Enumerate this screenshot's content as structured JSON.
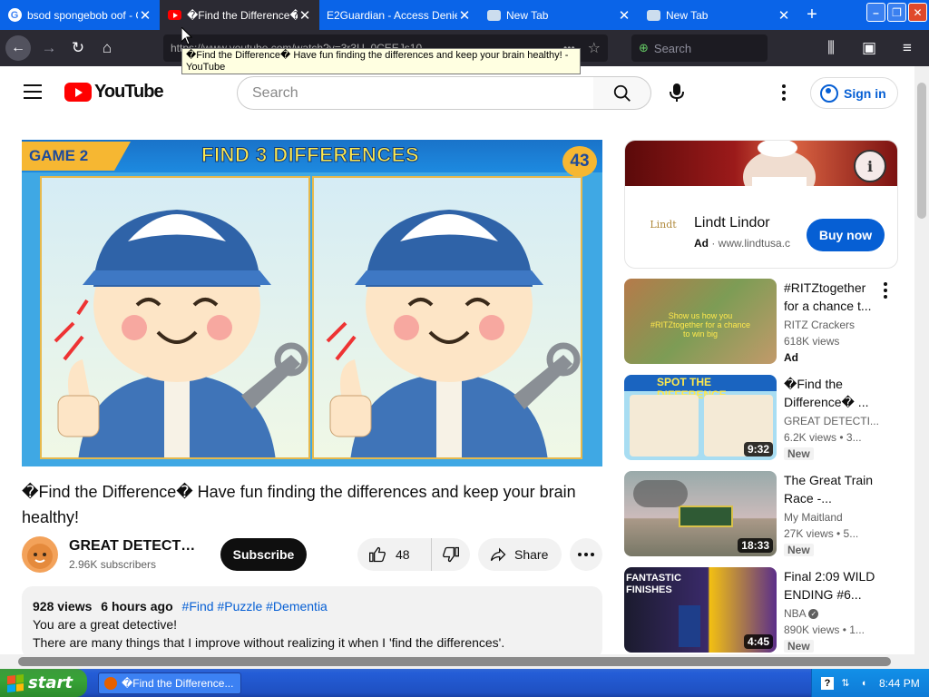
{
  "browser": {
    "tabs": [
      {
        "title": "bsod spongebob oof - G",
        "favicon": "google-icon",
        "active": false
      },
      {
        "title": "�Find the Difference�",
        "favicon": "youtube-icon",
        "active": true
      },
      {
        "title": "E2Guardian - Access Denied",
        "favicon": "none",
        "active": false
      },
      {
        "title": "New Tab",
        "favicon": "firefox-dog-icon",
        "active": false
      },
      {
        "title": "New Tab",
        "favicon": "firefox-dog-icon",
        "active": false
      }
    ],
    "url_text": "https://www.youtube.com/watch?v=3r3U_0CEEJs10",
    "search_placeholder": "Search",
    "tooltip": "�Find the Difference� Have fun finding the differences and keep your brain healthy! - YouTube"
  },
  "yt": {
    "logo_text": "YouTube",
    "search_placeholder": "Search",
    "signin_label": "Sign in"
  },
  "video": {
    "thumb_game": "GAME 2",
    "thumb_heading": "FIND 3 DIFFERENCES",
    "thumb_number": "43",
    "title": "�Find the Difference� Have fun finding the differences and keep your brain healthy!",
    "channel_name": "GREAT DETECTIVE",
    "channel_subs": "2.96K subscribers",
    "subscribe_label": "Subscribe",
    "likes": "48",
    "share_label": "Share",
    "description": {
      "views": "928 views",
      "age": "6 hours ago",
      "tags": "#Find #Puzzle #Dementia",
      "line1": "You are a great detective!",
      "line2": "There are many things that I improve without realizing it when I 'find the differences'."
    }
  },
  "ad": {
    "name": "Lindt Lindor",
    "label": "Ad",
    "domain": "www.lindtusa.c",
    "logo_text": "Lindt",
    "cta": "Buy now"
  },
  "recommendations": [
    {
      "title": "#RITZtogether for a chance t...",
      "channel": "RITZ Crackers",
      "views": "618K views",
      "badge": "Ad",
      "duration": "",
      "thumb_text": "Show us how you #RITZtogether for a chance to win big"
    },
    {
      "title": "�Find the Difference� ...",
      "channel": "GREAT DETECTI...",
      "views": "6.2K views • 3...",
      "badge": "New",
      "duration": "9:32",
      "thumb_text": "SPOT THE DIFFERENCE"
    },
    {
      "title": "The Great Train Race -...",
      "channel": "My Maitland",
      "views": "27K views • 5...",
      "badge": "New",
      "duration": "18:33",
      "thumb_text": ""
    },
    {
      "title": "Final 2:09 WILD ENDING #6...",
      "channel": "NBA",
      "views": "890K views • 1...",
      "badge": "New",
      "duration": "4:45",
      "thumb_text": "FANTASTIC FINISHES"
    }
  ],
  "taskbar": {
    "start_label": "start",
    "task_title": "�Find the Difference...",
    "clock": "8:44 PM"
  }
}
